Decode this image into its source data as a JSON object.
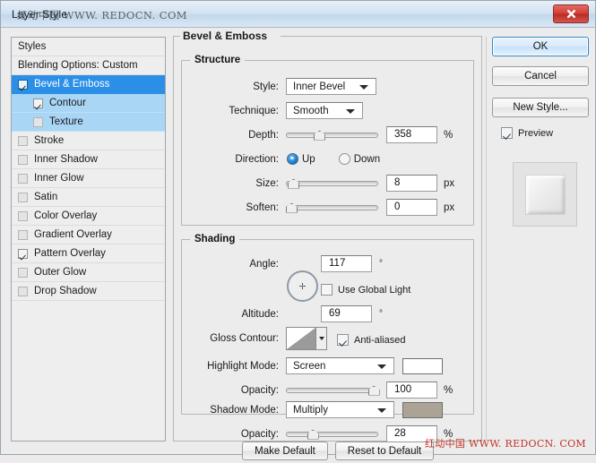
{
  "window": {
    "title": "Layer Style",
    "title_watermark": "红动中国 WWW. REDOCN. COM",
    "close_icon": "close-icon"
  },
  "sidebar": {
    "header": "Styles",
    "blending_options": "Blending Options: Custom",
    "items": [
      {
        "label": "Bevel & Emboss",
        "checked": true,
        "selected": true,
        "level": 0
      },
      {
        "label": "Contour",
        "checked": true,
        "selected": false,
        "level": 1
      },
      {
        "label": "Texture",
        "checked": false,
        "selected": false,
        "level": 1
      },
      {
        "label": "Stroke",
        "checked": false,
        "selected": false,
        "level": 0
      },
      {
        "label": "Inner Shadow",
        "checked": false,
        "selected": false,
        "level": 0
      },
      {
        "label": "Inner Glow",
        "checked": false,
        "selected": false,
        "level": 0
      },
      {
        "label": "Satin",
        "checked": false,
        "selected": false,
        "level": 0
      },
      {
        "label": "Color Overlay",
        "checked": false,
        "selected": false,
        "level": 0
      },
      {
        "label": "Gradient Overlay",
        "checked": false,
        "selected": false,
        "level": 0
      },
      {
        "label": "Pattern Overlay",
        "checked": true,
        "selected": false,
        "level": 0
      },
      {
        "label": "Outer Glow",
        "checked": false,
        "selected": false,
        "level": 0
      },
      {
        "label": "Drop Shadow",
        "checked": false,
        "selected": false,
        "level": 0
      }
    ]
  },
  "main": {
    "panel_title": "Bevel & Emboss",
    "structure": {
      "legend": "Structure",
      "style": {
        "label": "Style:",
        "value": "Inner Bevel"
      },
      "technique": {
        "label": "Technique:",
        "value": "Smooth"
      },
      "depth": {
        "label": "Depth:",
        "value": "358",
        "unit": "%",
        "slider_pct": 33
      },
      "direction": {
        "label": "Direction:",
        "up": "Up",
        "down": "Down",
        "selected": "Up"
      },
      "size": {
        "label": "Size:",
        "value": "8",
        "unit": "px",
        "slider_pct": 4
      },
      "soften": {
        "label": "Soften:",
        "value": "0",
        "unit": "px",
        "slider_pct": 1
      }
    },
    "shading": {
      "legend": "Shading",
      "angle": {
        "label": "Angle:",
        "value": "117",
        "unit": "°"
      },
      "use_global_light": {
        "label": "Use Global Light",
        "checked": false
      },
      "altitude": {
        "label": "Altitude:",
        "value": "69",
        "unit": "°"
      },
      "gloss_contour": {
        "label": "Gloss Contour:"
      },
      "anti_aliased": {
        "label": "Anti-aliased",
        "checked": true
      },
      "highlight_mode": {
        "label": "Highlight Mode:",
        "value": "Screen",
        "color": "#ffffff"
      },
      "highlight_opacity": {
        "label": "Opacity:",
        "value": "100",
        "unit": "%",
        "slider_pct": 95
      },
      "shadow_mode": {
        "label": "Shadow Mode:",
        "value": "Multiply",
        "color": "#aba396"
      },
      "shadow_opacity": {
        "label": "Opacity:",
        "value": "28",
        "unit": "%",
        "slider_pct": 26
      }
    }
  },
  "right": {
    "ok": "OK",
    "cancel": "Cancel",
    "new_style": "New Style...",
    "preview": {
      "label": "Preview",
      "checked": true
    }
  },
  "footer": {
    "make_default": "Make Default",
    "reset_to_default": "Reset to Default",
    "watermark": "红动中国 WWW. REDOCN. COM"
  }
}
